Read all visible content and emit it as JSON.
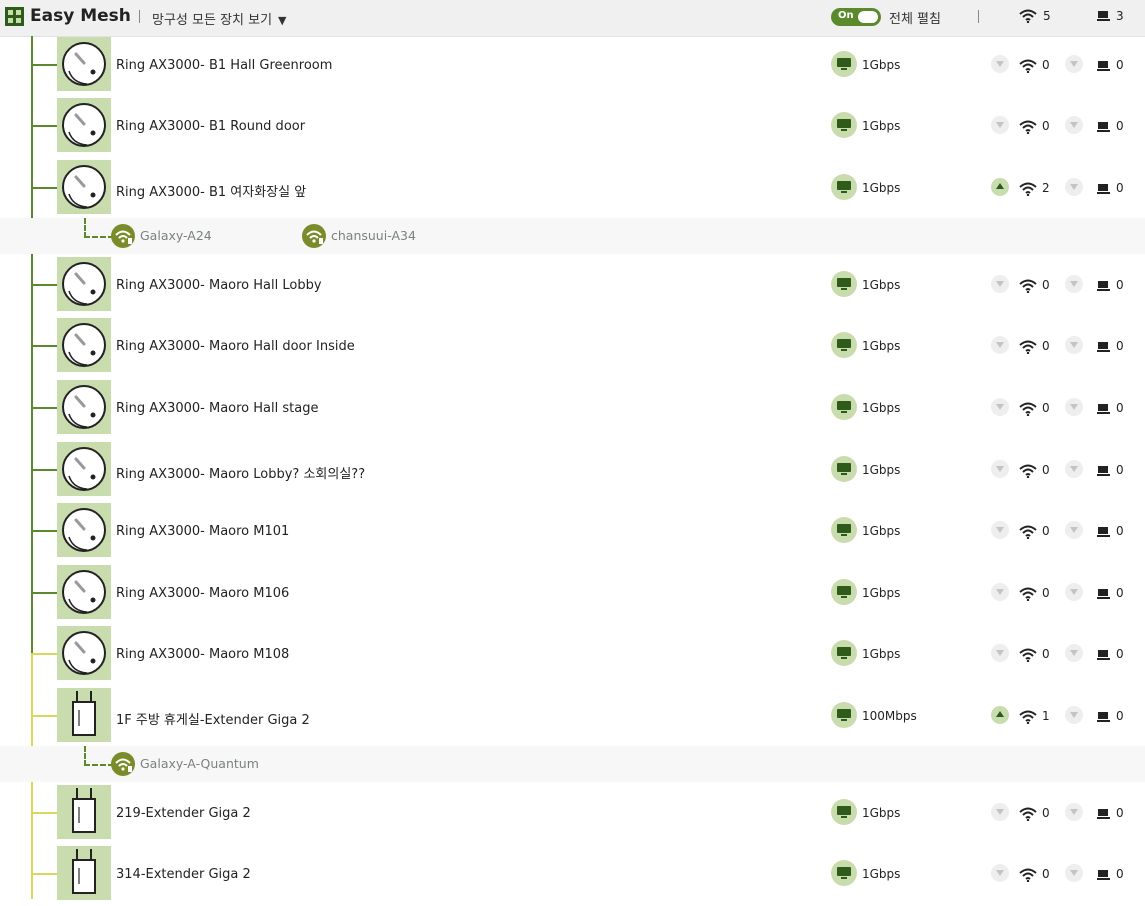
{
  "header": {
    "title": "Easy Mesh",
    "view_filter": "망구성 모든 장치 보기",
    "toggle_label": "On",
    "expand_all_label": "전체 펼침",
    "wifi_total": "5",
    "lan_total": "3"
  },
  "colors": {
    "accent_green": "#5b8a2d",
    "icon_bg": "#c9dcae",
    "client_icon": "#7a8c2a",
    "extender_line": "#d8d85a"
  },
  "devices": [
    {
      "name": "Ring AX3000- B1 Hall Greenroom",
      "icon": "ring-ap-icon",
      "speed": "1Gbps",
      "wifi": "0",
      "lan": "0",
      "expanded": false
    },
    {
      "name": "Ring AX3000- B1 Round door",
      "icon": "ring-ap-icon",
      "speed": "1Gbps",
      "wifi": "0",
      "lan": "0",
      "expanded": false
    },
    {
      "name": "Ring AX3000- B1 여자화장실 앞",
      "icon": "ring-ap-icon",
      "speed": "1Gbps",
      "wifi": "2",
      "lan": "0",
      "expanded": true
    },
    {
      "name": "Ring AX3000- Maoro Hall Lobby",
      "icon": "ring-ap-icon",
      "speed": "1Gbps",
      "wifi": "0",
      "lan": "0",
      "expanded": false
    },
    {
      "name": "Ring AX3000- Maoro Hall door Inside",
      "icon": "ring-ap-icon",
      "speed": "1Gbps",
      "wifi": "0",
      "lan": "0",
      "expanded": false
    },
    {
      "name": "Ring AX3000- Maoro Hall stage",
      "icon": "ring-ap-icon",
      "speed": "1Gbps",
      "wifi": "0",
      "lan": "0",
      "expanded": false
    },
    {
      "name": "Ring AX3000- Maoro Lobby? 소회의실??",
      "icon": "ring-ap-icon",
      "speed": "1Gbps",
      "wifi": "0",
      "lan": "0",
      "expanded": false
    },
    {
      "name": "Ring AX3000- Maoro M101",
      "icon": "ring-ap-icon",
      "speed": "1Gbps",
      "wifi": "0",
      "lan": "0",
      "expanded": false
    },
    {
      "name": "Ring AX3000- Maoro M106",
      "icon": "ring-ap-icon",
      "speed": "1Gbps",
      "wifi": "0",
      "lan": "0",
      "expanded": false
    },
    {
      "name": "Ring AX3000- Maoro M108",
      "icon": "ring-ap-icon",
      "speed": "1Gbps",
      "wifi": "0",
      "lan": "0",
      "expanded": false
    },
    {
      "name": "1F 주방 휴게실-Extender Giga 2",
      "icon": "extender-icon",
      "speed": "100Mbps",
      "wifi": "1",
      "lan": "0",
      "expanded": true
    },
    {
      "name": "219-Extender Giga 2",
      "icon": "extender-icon",
      "speed": "1Gbps",
      "wifi": "0",
      "lan": "0",
      "expanded": false
    },
    {
      "name": "314-Extender Giga 2",
      "icon": "extender-icon",
      "speed": "1Gbps",
      "wifi": "0",
      "lan": "0",
      "expanded": false
    }
  ],
  "client_groups": [
    {
      "clients": [
        "Galaxy-A24",
        "chansuui-A34"
      ]
    },
    {
      "clients": [
        "Galaxy-A-Quantum"
      ]
    }
  ]
}
